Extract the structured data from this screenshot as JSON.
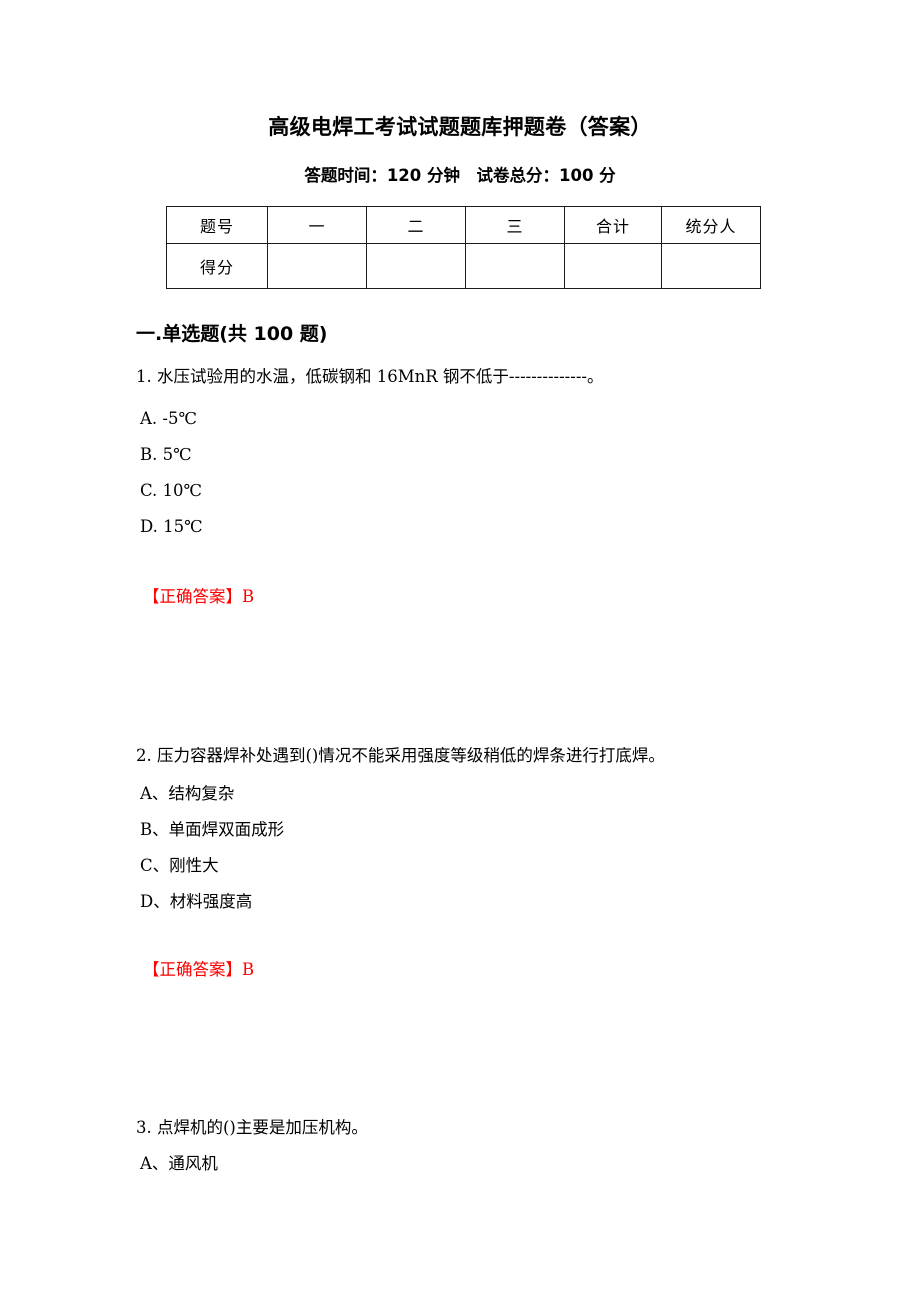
{
  "document": {
    "title": "高级电焊工考试试题题库押题卷（答案）",
    "subtitle": "答题时间：120 分钟　试卷总分：100 分"
  },
  "score_table": {
    "header": [
      "题号",
      "一",
      "二",
      "三",
      "合计",
      "统分人"
    ],
    "rows": [
      {
        "label": "得分",
        "cells": [
          "",
          "",
          "",
          "",
          ""
        ]
      }
    ]
  },
  "sections": [
    {
      "heading": "一.单选题(共 100 题)",
      "questions": [
        {
          "stem": "1. 水压试验用的水温，低碳钢和 16MnR 钢不低于--------------。",
          "options": [
            "A. -5℃",
            "B. 5℃",
            "C. 10℃",
            "D. 15℃"
          ],
          "answer_label": "【正确答案】",
          "answer_value": "B"
        },
        {
          "stem": "2. 压力容器焊补处遇到()情况不能采用强度等级稍低的焊条进行打底焊。",
          "options": [
            "A、结构复杂",
            "B、单面焊双面成形",
            "C、刚性大",
            "D、材料强度高"
          ],
          "answer_label": "【正确答案】",
          "answer_value": "B"
        },
        {
          "stem": "3. 点焊机的()主要是加压机构。",
          "options": [
            "A、通风机"
          ],
          "answer_label": "",
          "answer_value": ""
        }
      ]
    }
  ],
  "colors": {
    "answer_red": "#ff0000",
    "text_black": "#000000",
    "table_border": "#1a1a1a"
  }
}
